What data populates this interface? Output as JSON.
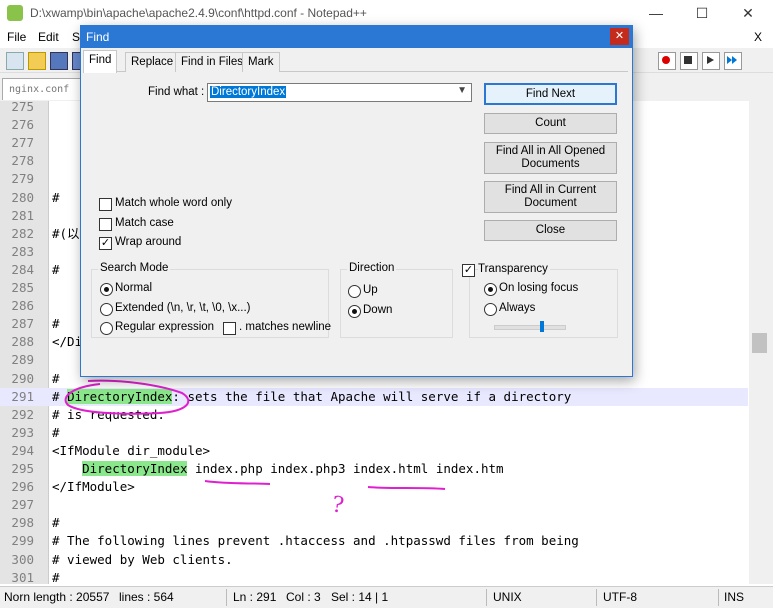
{
  "window": {
    "title": "D:\\xwamp\\bin\\apache\\apache2.4.9\\conf\\httpd.conf - Notepad++",
    "minimize": "—",
    "maximize": "☐",
    "close": "✕"
  },
  "menubar": {
    "items": [
      "File",
      "Edit",
      "Se"
    ],
    "close_glyph": "X"
  },
  "tabs": {
    "doc_tab": "nginx.conf"
  },
  "editor": {
    "lines": [
      {
        "n": "275",
        "text": ""
      },
      {
        "n": "276",
        "text": ""
      },
      {
        "n": "277",
        "text": ""
      },
      {
        "n": "278",
        "text": ""
      },
      {
        "n": "279",
        "text": ""
      },
      {
        "n": "280",
        "text": "#"
      },
      {
        "n": "281",
        "text": ""
      },
      {
        "n": "282",
        "text": "#(以"
      },
      {
        "n": "283",
        "text": ""
      },
      {
        "n": "284",
        "text": "#"
      },
      {
        "n": "285",
        "text": ""
      },
      {
        "n": "286",
        "text": ""
      },
      {
        "n": "287",
        "text": "#"
      },
      {
        "n": "288",
        "text": "</Di"
      },
      {
        "n": "289",
        "text": ""
      },
      {
        "n": "290",
        "text": "#"
      },
      {
        "n": "291",
        "pre": "# ",
        "hl": "DirectoryIndex",
        "post": ": sets the file that Apache will serve if a directory"
      },
      {
        "n": "292",
        "text": "# is requested."
      },
      {
        "n": "293",
        "text": "#"
      },
      {
        "n": "294",
        "text": "<IfModule dir_module>"
      },
      {
        "n": "295",
        "pre": "    ",
        "hl": "DirectoryIndex",
        "post": " index.php index.php3 index.html index.htm"
      },
      {
        "n": "296",
        "text": "</IfModule>"
      },
      {
        "n": "297",
        "text": ""
      },
      {
        "n": "298",
        "text": "#"
      },
      {
        "n": "299",
        "text": "# The following lines prevent .htaccess and .htpasswd files from being"
      },
      {
        "n": "300",
        "text": "# viewed by Web clients."
      },
      {
        "n": "301",
        "text": "#"
      }
    ],
    "annotation_mark": "?"
  },
  "find_dialog": {
    "title": "Find",
    "close": "✕",
    "tabs": [
      "Find",
      "Replace",
      "Find in Files",
      "Mark"
    ],
    "find_what_label": "Find what :",
    "find_what_value": "DirectoryIndex",
    "buttons": {
      "find_next": "Find Next",
      "count": "Count",
      "find_all_opened_1": "Find All in All Opened",
      "find_all_opened_2": "Documents",
      "find_all_current_1": "Find All in Current",
      "find_all_current_2": "Document",
      "close": "Close"
    },
    "options": {
      "match_whole_word": {
        "label": "Match whole word only",
        "checked": false
      },
      "match_case": {
        "label": "Match case",
        "checked": false
      },
      "wrap_around": {
        "label": "Wrap around",
        "checked": true
      }
    },
    "search_mode": {
      "label": "Search Mode",
      "normal": "Normal",
      "extended": "Extended (\\n, \\r, \\t, \\0, \\x...)",
      "regex": "Regular expression",
      "matches_newline": ". matches newline",
      "selected": "Normal"
    },
    "direction": {
      "label": "Direction",
      "up": "Up",
      "down": "Down",
      "selected": "Down"
    },
    "transparency": {
      "label": "Transparency",
      "checked": true,
      "on_losing_focus": "On losing focus",
      "always": "Always",
      "selected": "On losing focus",
      "level": 0.7
    }
  },
  "statusbar": {
    "length": "Norn length : 20557",
    "lines": "lines : 564",
    "ln": "Ln : 291",
    "col": "Col : 3",
    "sel": "Sel : 14 | 1",
    "eol": "UNIX",
    "encoding": "UTF-8",
    "mode": "INS"
  },
  "colors": {
    "accent": "#2b78d4",
    "highlight": "#8be78b",
    "annotation": "#e020d0"
  }
}
